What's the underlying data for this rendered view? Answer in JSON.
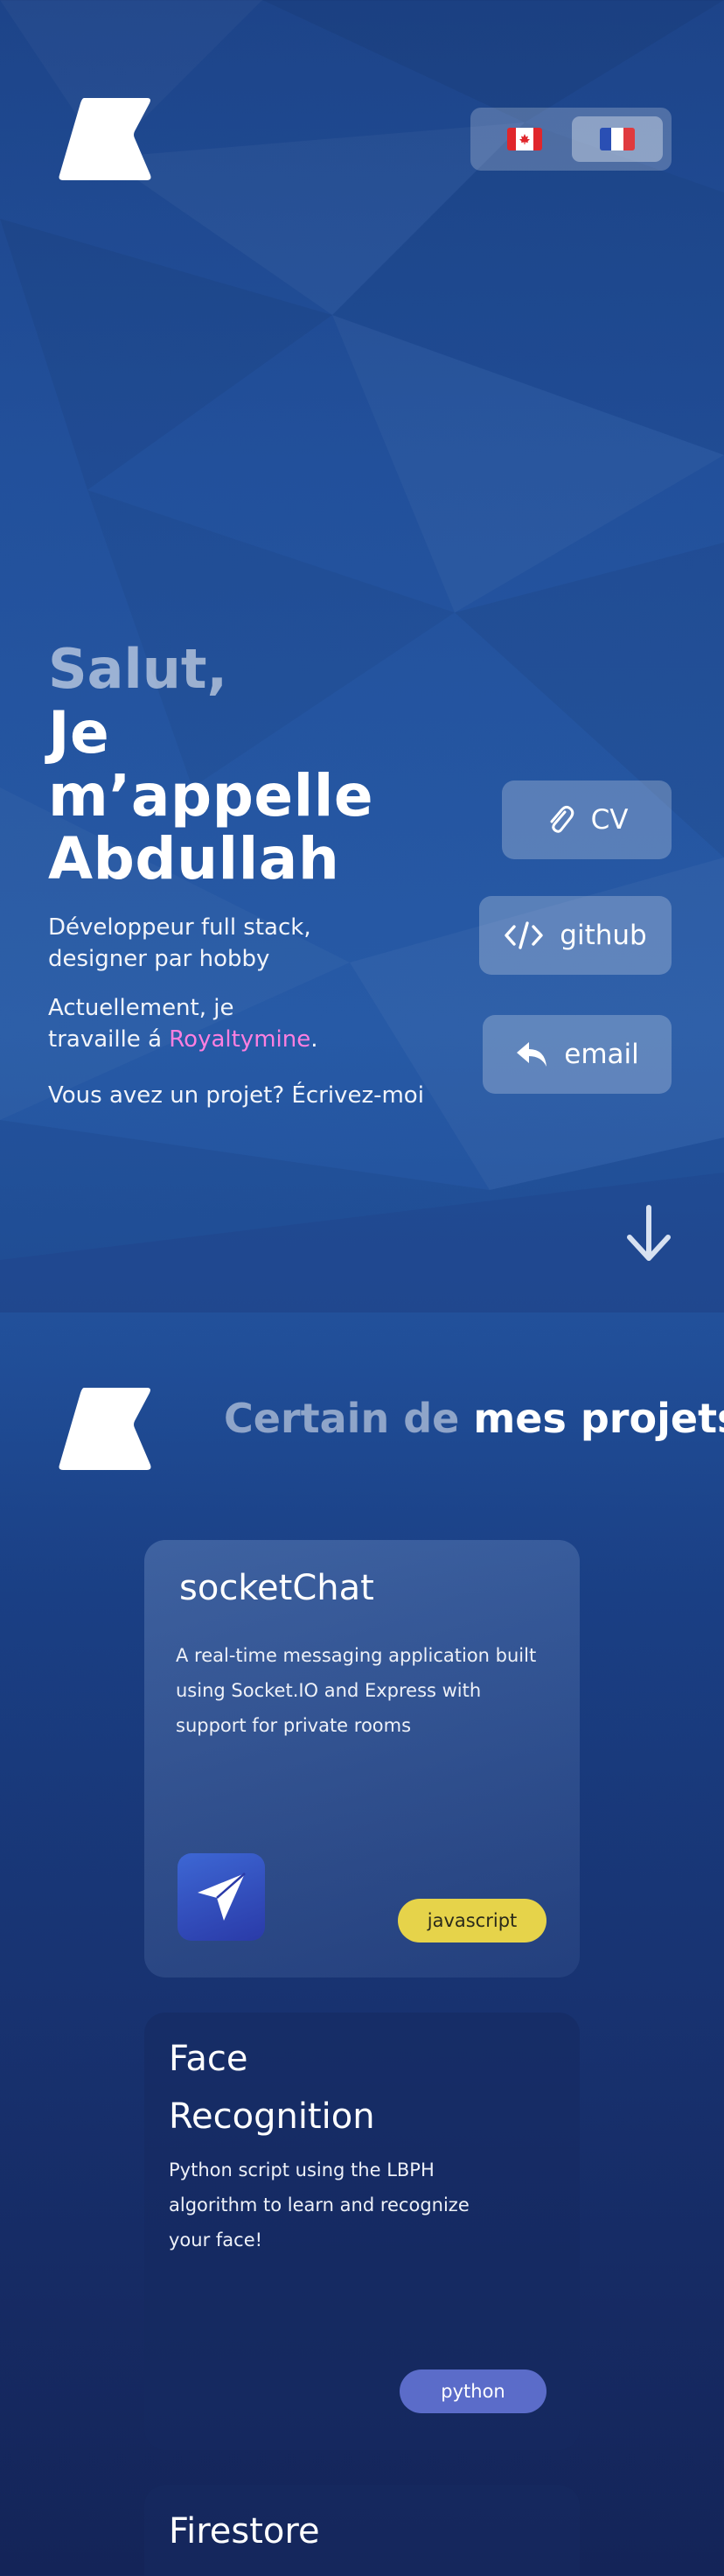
{
  "header": {
    "languages": [
      {
        "code": "en-CA",
        "icon": "canada-flag-icon"
      },
      {
        "code": "fr",
        "icon": "france-flag-icon",
        "active": true
      }
    ]
  },
  "hero": {
    "greeting": "Salut,",
    "name_line1": "Je m’appelle",
    "name_line2": "Abdullah",
    "role_line1": "Développeur full stack,",
    "role_line2": "designer par hobby",
    "work_line1": "Actuellement, je",
    "work_prefix": "travaille á ",
    "work_company": "Royaltymine",
    "work_suffix": ".",
    "contact_prompt": "Vous avez un projet? Écrivez-moi"
  },
  "actions": {
    "cv_label": "CV",
    "github_label": "github",
    "email_label": "email"
  },
  "projects_section": {
    "title_muted": "Certain de",
    "title_strong": "mes projets"
  },
  "projects": [
    {
      "title": "socketChat",
      "description_lines": [
        "A real-time messaging application built",
        "using Socket.IO and Express with",
        "support for private rooms"
      ],
      "tag": "javascript"
    },
    {
      "title_lines": [
        "Face",
        "Recognition"
      ],
      "description_lines": [
        "Python script using the LBPH",
        "algorithm to learn and recognize",
        "your face!"
      ],
      "tag": "python"
    },
    {
      "title": "Firestore"
    }
  ],
  "colors": {
    "accent_pink": "#ff7fe0",
    "tag_javascript": "#e6d34a",
    "tag_python": "#5b6cc9"
  }
}
